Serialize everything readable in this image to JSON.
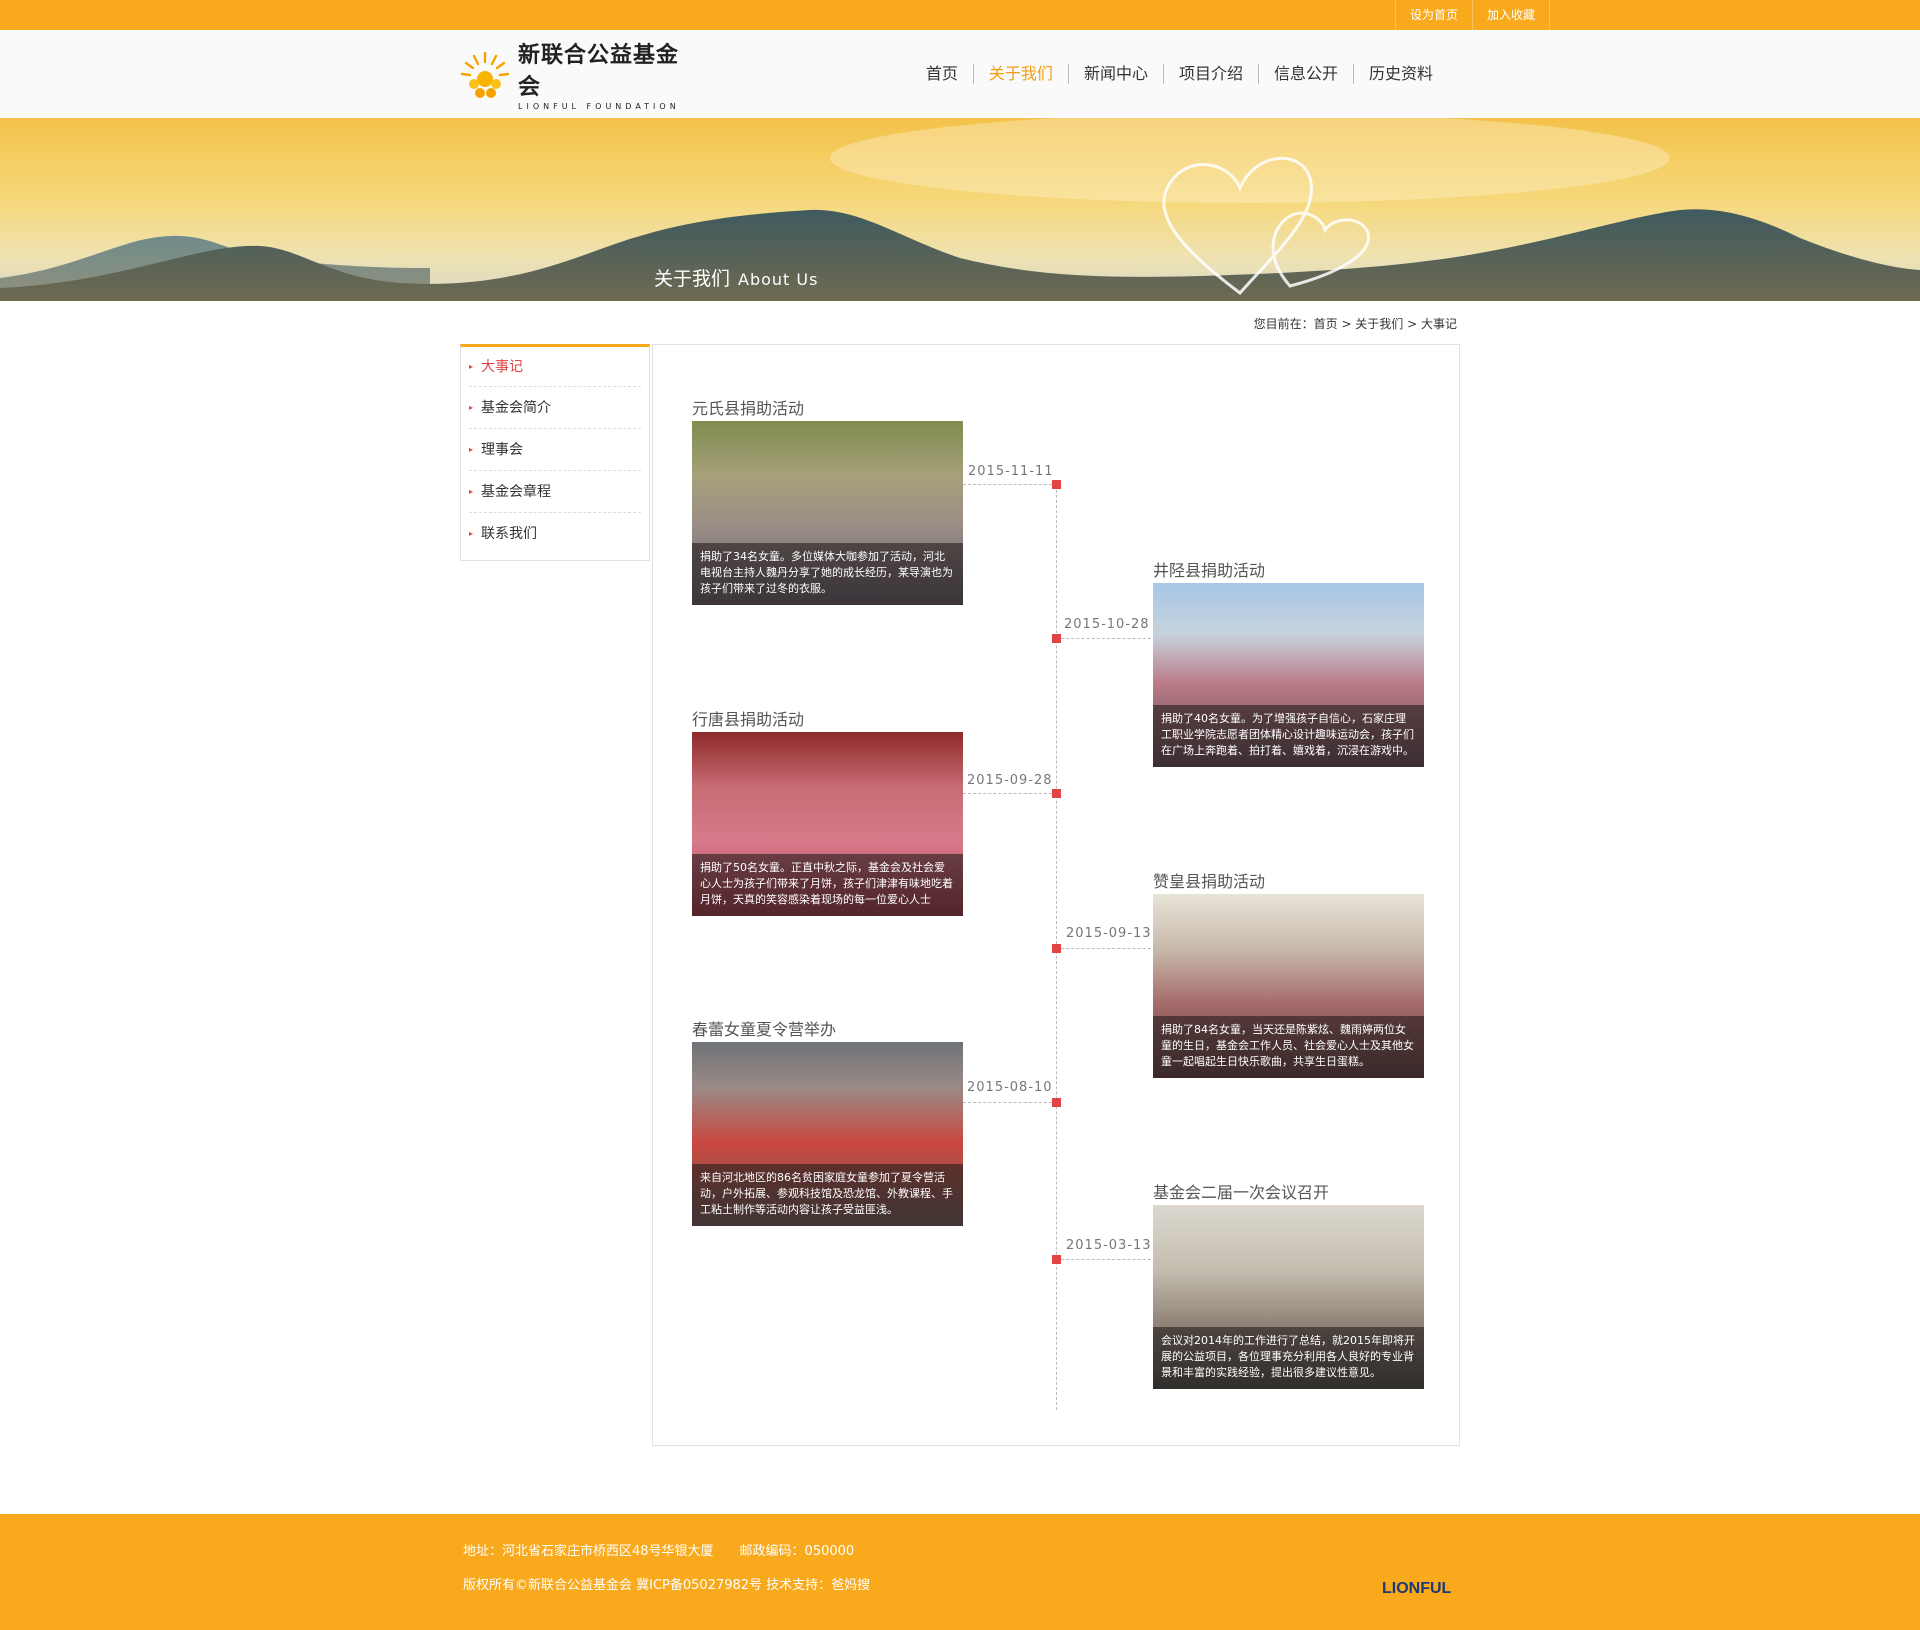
{
  "topbar": {
    "links": [
      "设为首页",
      "加入收藏"
    ]
  },
  "logo": {
    "cn": "新联合公益基金会",
    "en": "LIONFUL FOUNDATION"
  },
  "nav": {
    "items": [
      "首页",
      "关于我们",
      "新闻中心",
      "项目介绍",
      "信息公开",
      "历史资料"
    ],
    "active": "关于我们"
  },
  "banner": {
    "title_cn": "关于我们",
    "title_en": "About Us"
  },
  "breadcrumb": {
    "text": "您目前在：首页 > 关于我们 > 大事记"
  },
  "sidebar": {
    "items": [
      "大事记",
      "基金会简介",
      "理事会",
      "基金会章程",
      "联系我们"
    ],
    "active": "大事记"
  },
  "timeline": [
    {
      "title": "元氏县捐助活动",
      "date": "2015-11-11",
      "caption": "捐助了34名女童。多位媒体大咖参加了活动，河北电视台主持人魏丹分享了她的成长经历，某导演也为孩子们带来了过冬的衣服。"
    },
    {
      "title": "井陉县捐助活动",
      "date": "2015-10-28",
      "caption": "捐助了40名女童。为了增强孩子自信心，石家庄理工职业学院志愿者团体精心设计趣味运动会，孩子们在广场上奔跑着、拍打着、嬉戏着，沉浸在游戏中。"
    },
    {
      "title": "行唐县捐助活动",
      "date": "2015-09-28",
      "caption": "捐助了50名女童。正直中秋之际，基金会及社会爱心人士为孩子们带来了月饼，孩子们津津有味地吃着月饼，天真的笑容感染着现场的每一位爱心人士"
    },
    {
      "title": "赞皇县捐助活动",
      "date": "2015-09-13",
      "caption": "捐助了84名女童，当天还是陈紫炫、魏雨婷两位女童的生日，基金会工作人员、社会爱心人士及其他女童一起唱起生日快乐歌曲，共享生日蛋糕。"
    },
    {
      "title": "春蕾女童夏令营举办",
      "date": "2015-08-10",
      "caption": "来自河北地区的86名贫困家庭女童参加了夏令营活动，户外拓展、参观科技馆及恐龙馆、外教课程、手工粘土制作等活动内容让孩子受益匪浅。"
    },
    {
      "title": "基金会二届一次会议召开",
      "date": "2015-03-13",
      "caption": "会议对2014年的工作进行了总结，就2015年即将开展的公益项目，各位理事充分利用各人良好的专业背景和丰富的实践经验，提出很多建议性意见。"
    }
  ],
  "footer": {
    "address": "地址：河北省石家庄市桥西区48号华银大厦　　邮政编码：050000",
    "copyright": "版权所有©新联合公益基金会 冀ICP备05027982号 技术支持：爸妈搜",
    "logo": "LIONFUL"
  },
  "colors": {
    "brand_orange": "#f9a91c",
    "accent_red": "#e14444",
    "active_nav": "#f39c12"
  }
}
